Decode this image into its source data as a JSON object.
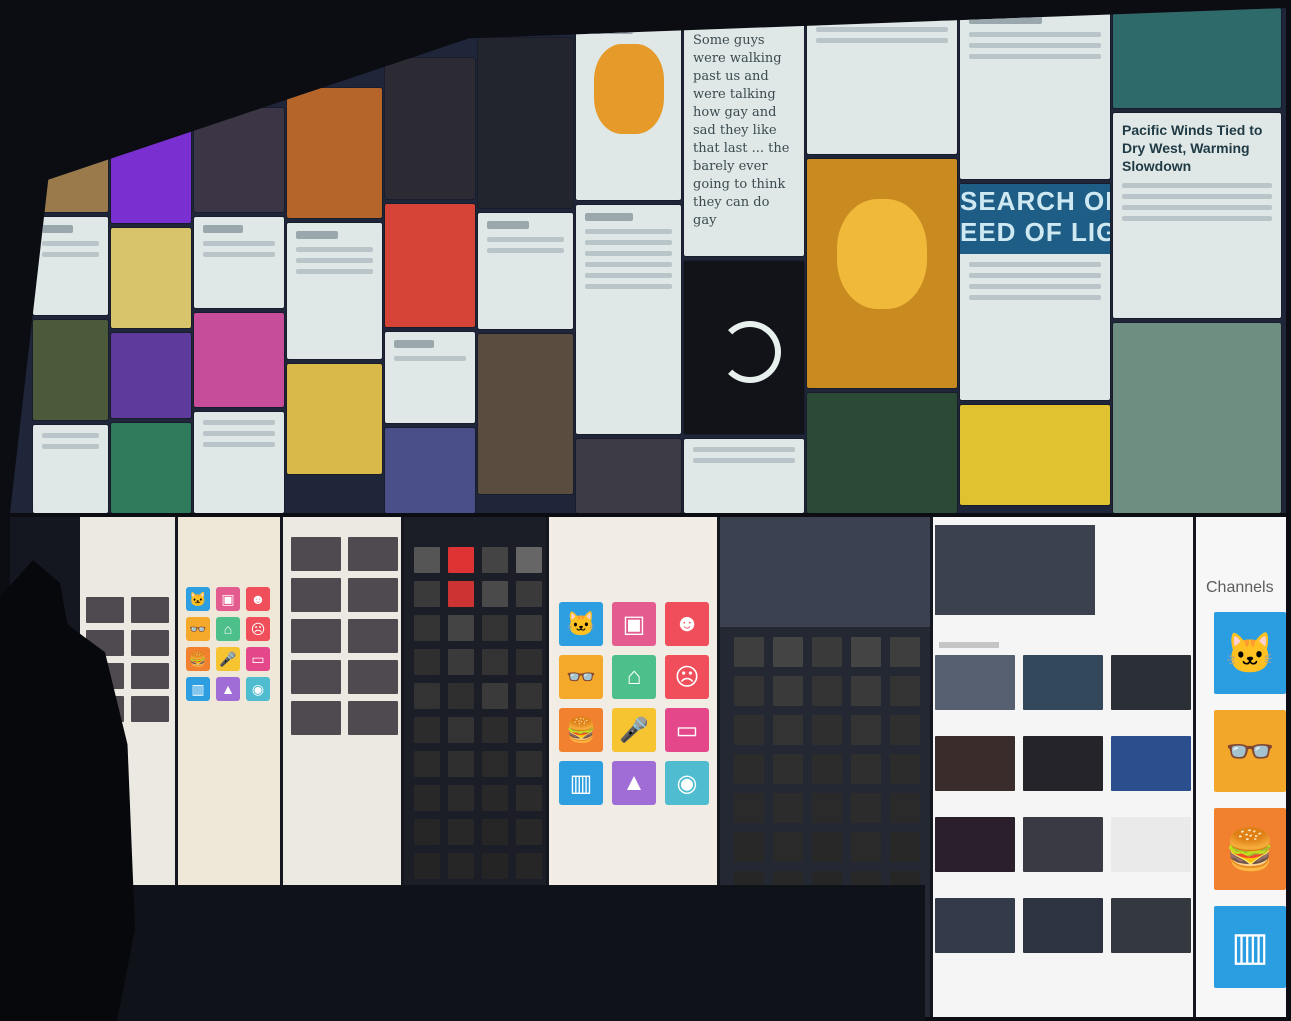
{
  "top_wall": {
    "quote_text": "Some guys were walking past us and were talking how gay and sad they like that last ... the barely ever going to think they can do gay",
    "headline_pacific": "Pacific Winds Tied to Dry West, Warming Slowdown",
    "sign_line_1": "SEARCH OF T",
    "sign_line_2": "EED OF LIG"
  },
  "bottom_wall": {
    "channels_label": "Channels",
    "channel_tiles": [
      {
        "icon": "cat-icon",
        "glyph": "🐱",
        "color": "#2a9ee0"
      },
      {
        "icon": "glasses-icon",
        "glyph": "👓",
        "color": "#f2a62a"
      },
      {
        "icon": "burger-icon",
        "glyph": "🍔",
        "color": "#f1812e"
      },
      {
        "icon": "piano-icon",
        "glyph": "▥",
        "color": "#2a9ee0"
      }
    ],
    "grid_tiles": [
      {
        "icon": "cat-icon",
        "glyph": "🐱",
        "color": "#2d9fe1"
      },
      {
        "icon": "portrait-icon",
        "glyph": "▣",
        "color": "#e35b8f"
      },
      {
        "icon": "face-icon",
        "glyph": "☻",
        "color": "#ef4e5a"
      },
      {
        "icon": "glasses-icon",
        "glyph": "👓",
        "color": "#f4a92b"
      },
      {
        "icon": "house-icon",
        "glyph": "⌂",
        "color": "#4cbf8a"
      },
      {
        "icon": "monster-icon",
        "glyph": "☹",
        "color": "#ef4e5a"
      },
      {
        "icon": "burger-icon",
        "glyph": "🍔",
        "color": "#f1812e"
      },
      {
        "icon": "microphone-icon",
        "glyph": "🎤",
        "color": "#f5c430"
      },
      {
        "icon": "tv-icon",
        "glyph": "▭",
        "color": "#e5488a"
      },
      {
        "icon": "piano-icon",
        "glyph": "▥",
        "color": "#2d9fe1"
      },
      {
        "icon": "mountain-icon",
        "glyph": "▲",
        "color": "#a06cd5"
      },
      {
        "icon": "coin-icon",
        "glyph": "◉",
        "color": "#4fbccf"
      }
    ]
  }
}
